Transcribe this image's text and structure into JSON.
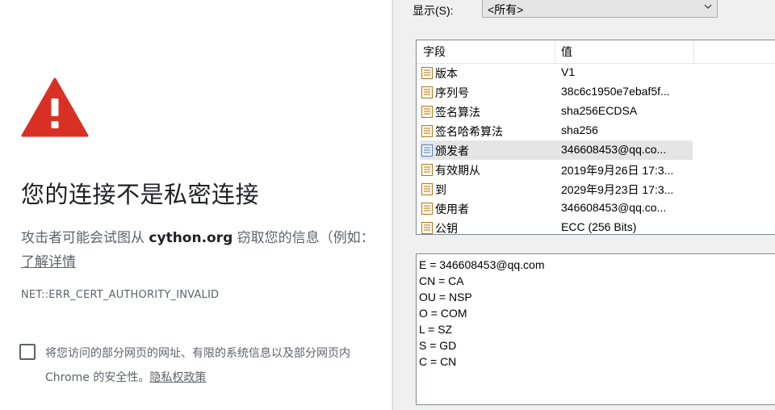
{
  "interstitial": {
    "heading": "您的连接不是私密连接",
    "desc_prefix": "攻击者可能会试图从 ",
    "desc_domain": "cython.org",
    "desc_suffix": " 窃取您的信息（例如：",
    "learn_more": "了解详情",
    "error_code": "NET::ERR_CERT_AUTHORITY_INVALID",
    "optin_line1": "将您访问的部分网页的网址、有限的系统信息以及部分网页内",
    "optin_line2": "Chrome 的安全性。",
    "privacy_link": "隐私权政策",
    "warning_color": "#d93025"
  },
  "cert_dialog": {
    "show_label": "显示(S):",
    "show_value": "<所有>",
    "columns": {
      "field": "字段",
      "value": "值"
    },
    "fields": [
      {
        "name": "版本",
        "value": "V1",
        "icon": "field-icon"
      },
      {
        "name": "序列号",
        "value": "38c6c1950e7ebaf5f...",
        "icon": "field-icon"
      },
      {
        "name": "签名算法",
        "value": "sha256ECDSA",
        "icon": "field-icon"
      },
      {
        "name": "签名哈希算法",
        "value": "sha256",
        "icon": "field-icon"
      },
      {
        "name": "颁发者",
        "value": "346608453@qq.co...",
        "icon": "field-icon-blue",
        "selected": true
      },
      {
        "name": "有效期从",
        "value": "2019年9月26日 17:3...",
        "icon": "field-icon"
      },
      {
        "name": "到",
        "value": "2029年9月23日 17:3...",
        "icon": "field-icon"
      },
      {
        "name": "使用者",
        "value": "346608453@qq.co...",
        "icon": "field-icon"
      },
      {
        "name": "公钥",
        "value": "ECC (256 Bits)",
        "icon": "field-icon"
      }
    ],
    "details": [
      "E = 346608453@qq.com",
      "CN = CA",
      "OU = NSP",
      "O = COM",
      "L = SZ",
      "S = GD",
      "C = CN"
    ]
  }
}
